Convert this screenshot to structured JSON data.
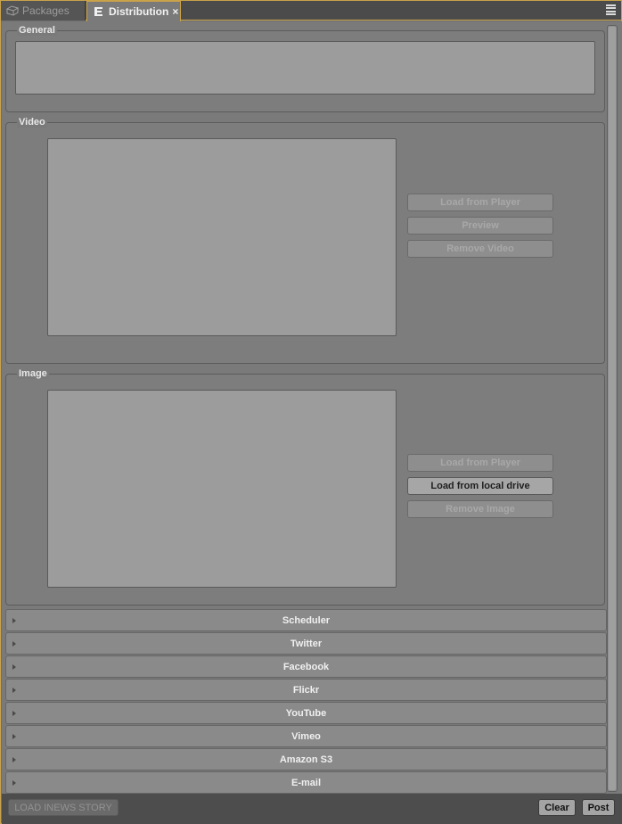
{
  "tabs": [
    {
      "label": "Packages",
      "icon": "packages-icon",
      "active": false
    },
    {
      "label": "Distribution",
      "icon": "distribution-icon",
      "active": true,
      "close": "×"
    }
  ],
  "general": {
    "label": "General"
  },
  "video": {
    "label": "Video",
    "buttons": {
      "load_from_player": "Load from Player",
      "preview": "Preview",
      "remove_video": "Remove Video"
    }
  },
  "image": {
    "label": "Image",
    "buttons": {
      "load_from_player": "Load from Player",
      "load_from_local_drive": "Load from local drive",
      "remove_image": "Remove Image"
    }
  },
  "sections": [
    "Scheduler",
    "Twitter",
    "Facebook",
    "Flickr",
    "YouTube",
    "Vimeo",
    "Amazon S3",
    "E-mail"
  ],
  "footer": {
    "load_inews_story": "LOAD INEWS STORY",
    "clear": "Clear",
    "post": "Post"
  },
  "colors": {
    "accent": "#c9a24a"
  }
}
